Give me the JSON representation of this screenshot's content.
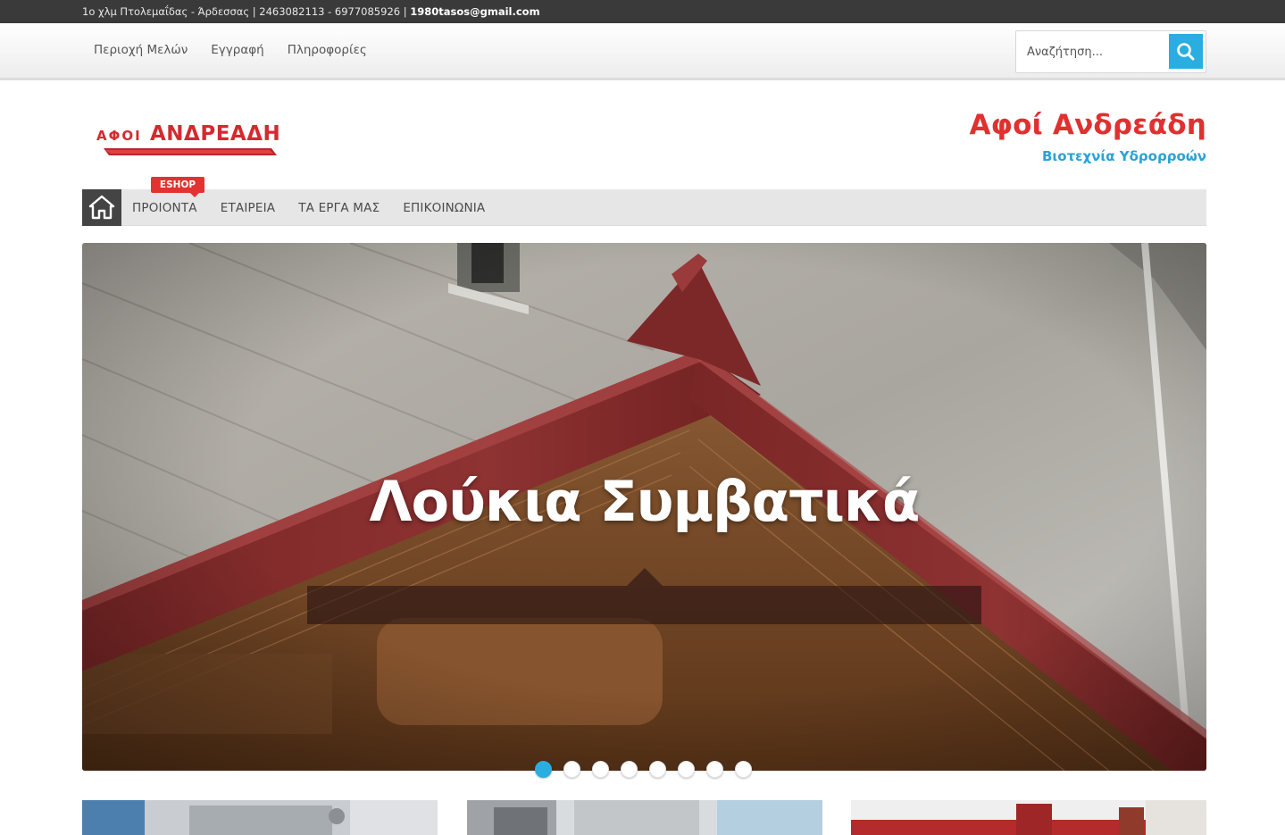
{
  "topbar": {
    "address": "1ο χλμ Πτολεμαΐδας - Άρδεσσας | 2463082113 - 6977085926 | ",
    "email": "1980tasos@gmail.com"
  },
  "util_links": [
    "Περιοχή Μελών",
    "Εγγραφή",
    "Πληροφορίες"
  ],
  "search": {
    "placeholder": "Αναζήτηση..."
  },
  "logo": {
    "text": "ΑΦΟΙ ΑΝΔΡΕΑΔΗ"
  },
  "brand": {
    "title": "Αφοί Ανδρεάδη",
    "subtitle": "Βιοτεχνία Υδρορροών"
  },
  "nav": {
    "badge": "ESHOP",
    "items": [
      "ΠΡΟΙΟΝΤΑ",
      "ΕΤΑΙΡΕΙΑ",
      "ΤΑ ΕΡΓΑ ΜΑΣ",
      "ΕΠΙΚΟΙΝΩΝΙΑ"
    ]
  },
  "slider": {
    "caption": "Λούκια Συμβατικά",
    "slide_count": 8,
    "active_slide": 1
  },
  "colors": {
    "accent_blue": "#2aaee0",
    "brand_red": "#e0302f",
    "topbar": "#3a3a3a"
  },
  "icons": [
    "search-icon",
    "home-icon"
  ]
}
